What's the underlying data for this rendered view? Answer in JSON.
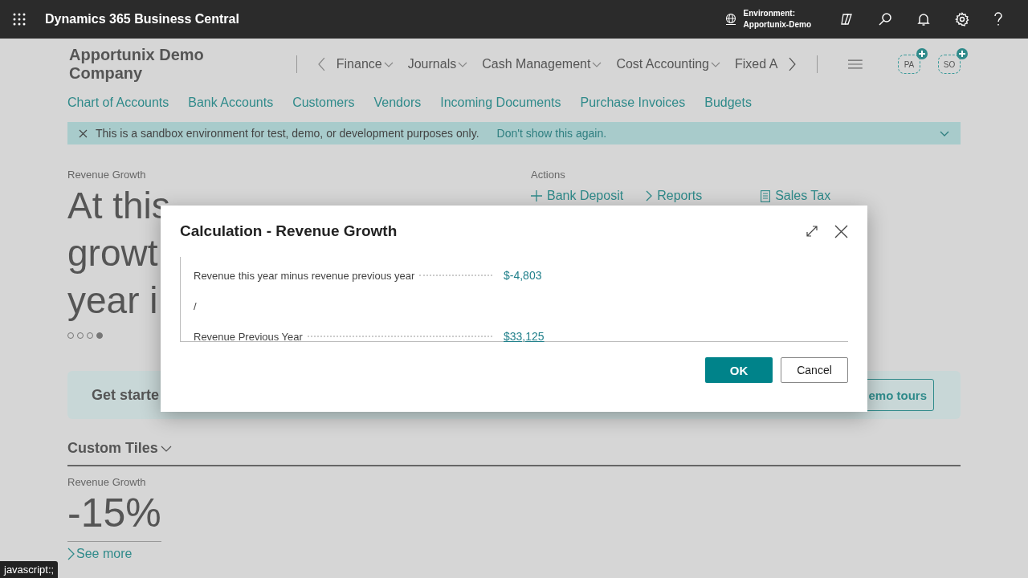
{
  "top_bar": {
    "app_name": "Dynamics 365 Business Central",
    "environment_label": "Environment:",
    "environment_name": "Apportunix-Demo"
  },
  "nav": {
    "company": "Apportunix Demo Company",
    "menus": [
      {
        "label": "Finance"
      },
      {
        "label": "Journals"
      },
      {
        "label": "Cash Management"
      },
      {
        "label": "Cost Accounting"
      }
    ],
    "cut_menu": "Fixed A",
    "avatars": [
      "PA",
      "SO"
    ]
  },
  "links": [
    "Chart of Accounts",
    "Bank Accounts",
    "Customers",
    "Vendors",
    "Incoming Documents",
    "Purchase Invoices",
    "Budgets"
  ],
  "banner": {
    "message": "This is a sandbox environment for test, demo, or development purposes only.",
    "link": "Don't show this again."
  },
  "headline": {
    "label": "Revenue Growth",
    "lines": [
      "At this",
      "growt",
      "year i"
    ],
    "dots": [
      {
        "selected": false
      },
      {
        "selected": false
      },
      {
        "selected": false
      },
      {
        "selected": true
      }
    ]
  },
  "actions": {
    "title": "Actions",
    "items": [
      {
        "kind": "plus",
        "label": "Bank Deposit"
      },
      {
        "kind": "chevron",
        "label": "Reports"
      },
      {
        "kind": "doc",
        "label": "Sales Tax"
      }
    ]
  },
  "get_started": {
    "title": "Get starte",
    "button": "emo tours"
  },
  "custom_tiles": {
    "title": "Custom Tiles",
    "tile_label": "Revenue Growth",
    "tile_value": "-15%",
    "see_more": "See more"
  },
  "dialog": {
    "title": "Calculation - Revenue Growth",
    "rows": [
      {
        "kind": "value",
        "label": "Revenue this year minus revenue previous year",
        "value": "$-4,803",
        "hovered": false
      },
      {
        "kind": "operator",
        "label": "/"
      },
      {
        "kind": "value",
        "label": "Revenue Previous Year",
        "value": "$33,125",
        "hovered": true
      }
    ],
    "ok": "OK",
    "cancel": "Cancel"
  },
  "status_text": "javascript:;"
}
